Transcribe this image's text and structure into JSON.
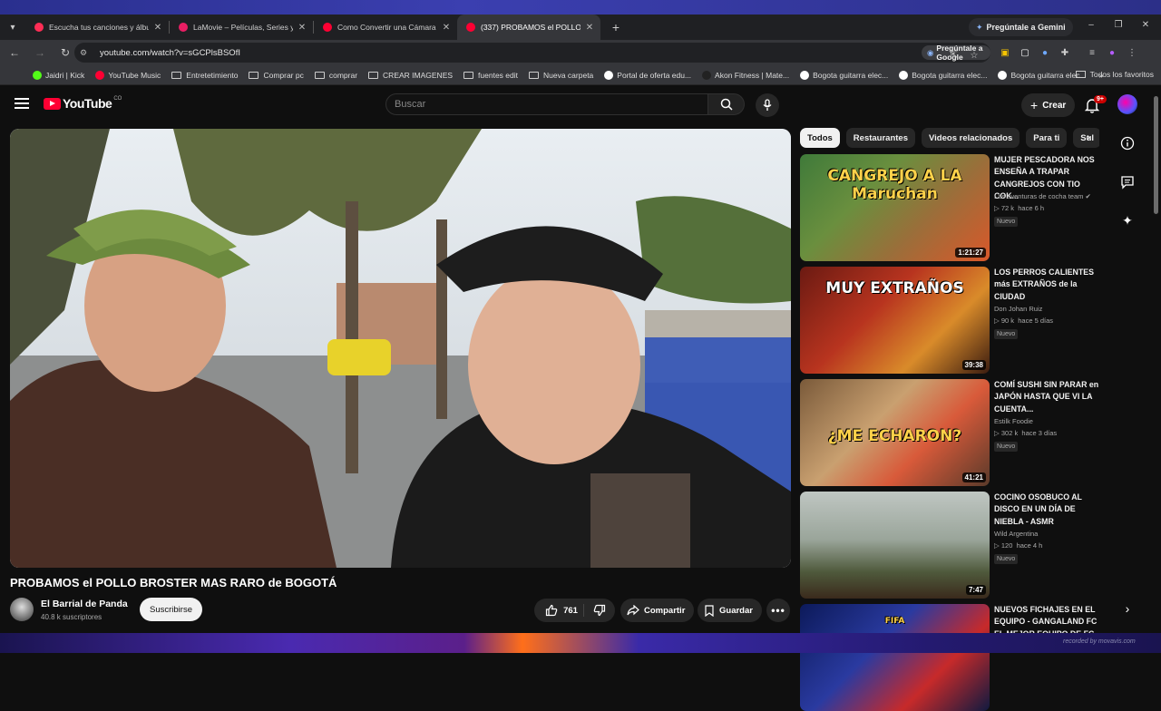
{
  "browser": {
    "tabs": [
      {
        "title": "Escucha tus canciones y álbumes",
        "favicon_color": "#ff2d55",
        "active": false
      },
      {
        "title": "LaMovie – Películas, Series y Anime",
        "favicon_color": "#e91e63",
        "active": false
      },
      {
        "title": "Como Convertir una Cámara de",
        "favicon_color": "#ff0033",
        "active": false
      },
      {
        "title": "(337) PROBAMOS el POLLO BROSTER",
        "favicon_color": "#ff0033",
        "active": true
      }
    ],
    "new_tab": "+",
    "gemini_button": "Pregúntale a Gemini",
    "url": "youtube.com/watch?v=sGCPlsBSOfI",
    "ask_google": "Pregúntale a Google",
    "bookmarks": [
      {
        "label": "Jaidri | Kick",
        "type": "site",
        "color": "#53fc18"
      },
      {
        "label": "YouTube Music",
        "type": "site",
        "color": "#ff0033"
      },
      {
        "label": "Entretetimiento",
        "type": "folder"
      },
      {
        "label": "Comprar pc",
        "type": "folder"
      },
      {
        "label": "comprar",
        "type": "folder"
      },
      {
        "label": "CREAR IMAGENES",
        "type": "folder"
      },
      {
        "label": "fuentes edit",
        "type": "folder"
      },
      {
        "label": "Nueva carpeta",
        "type": "folder"
      },
      {
        "label": "Portal de oferta edu...",
        "type": "site",
        "color": "#ffffff"
      },
      {
        "label": "Akon Fitness | Mate...",
        "type": "site",
        "color": "#222222"
      },
      {
        "label": "Bogota guitarra elec...",
        "type": "site",
        "color": "#ffffff"
      },
      {
        "label": "Bogota guitarra elec...",
        "type": "site",
        "color": "#ffffff"
      },
      {
        "label": "Bogota guitarra elec...",
        "type": "site",
        "color": "#ffffff"
      }
    ],
    "more_bookmarks": "»",
    "all_bookmarks": "Todos los favoritos"
  },
  "youtube": {
    "logo": "YouTube",
    "country": "CO",
    "search_placeholder": "Buscar",
    "create_label": "Crear",
    "notif_count": "9+",
    "video": {
      "title": "PROBAMOS el POLLO BROSTER MAS RARO de BOGOTÁ",
      "channel": "El Barrial de Panda",
      "subscribers": "40.8 k suscriptores",
      "subscribe_label": "Suscribirse",
      "likes": "761",
      "share_label": "Compartir",
      "save_label": "Guardar"
    },
    "chips": [
      "Todos",
      "Restaurantes",
      "Videos relacionados",
      "Para ti",
      "Sul"
    ],
    "recommendations": [
      {
        "title": "MUJER PESCADORA NOS ENSEÑA A TRAPAR CANGREJOS CON TIO COK...",
        "channel": "Las aventuras de cocha team",
        "verified": true,
        "views": "72 k",
        "age": "hace 6 h",
        "badge": "Nuevo",
        "duration": "1:21:27",
        "thumb_text": "CANGREJO A LA Maruchan"
      },
      {
        "title": "LOS PERROS CALIENTES más EXTRAÑOS de la CIUDAD",
        "channel": "Don Johan Ruiz",
        "verified": false,
        "views": "90 k",
        "age": "hace 5 días",
        "badge": "Nuevo",
        "duration": "39:38",
        "thumb_text": "MUY EXTRAÑOS"
      },
      {
        "title": "COMÍ SUSHI SIN PARAR en JAPÓN HASTA QUE VI LA CUENTA...",
        "channel": "Estilk Foodie",
        "verified": false,
        "views": "302 k",
        "age": "hace 3 días",
        "badge": "Nuevo",
        "duration": "41:21",
        "thumb_text": "¿ME ECHARON?"
      },
      {
        "title": "COCINO OSOBUCO AL DISCO  EN UN DÍA DE NIEBLA - ASMR",
        "channel": "Wild Argentina",
        "verified": false,
        "views": "120",
        "age": "hace 4 h",
        "badge": "Nuevo",
        "duration": "7:47",
        "thumb_text": ""
      },
      {
        "title": "NUEVOS FICHAJES EN EL EQUIPO - GANGALAND FC EL MEJOR EQUIPO DE FC 2...",
        "channel": "",
        "verified": false,
        "views": "",
        "age": "",
        "badge": "",
        "duration": "",
        "thumb_text": "FIFA"
      }
    ],
    "views_prefix": "▷"
  },
  "watermark": "recorded by movavis.com",
  "colors": {
    "yt_red": "#ff0033",
    "bg": "#0f0f0f",
    "chip_bg": "#272727",
    "accent_blue": "#3ea6ff"
  }
}
